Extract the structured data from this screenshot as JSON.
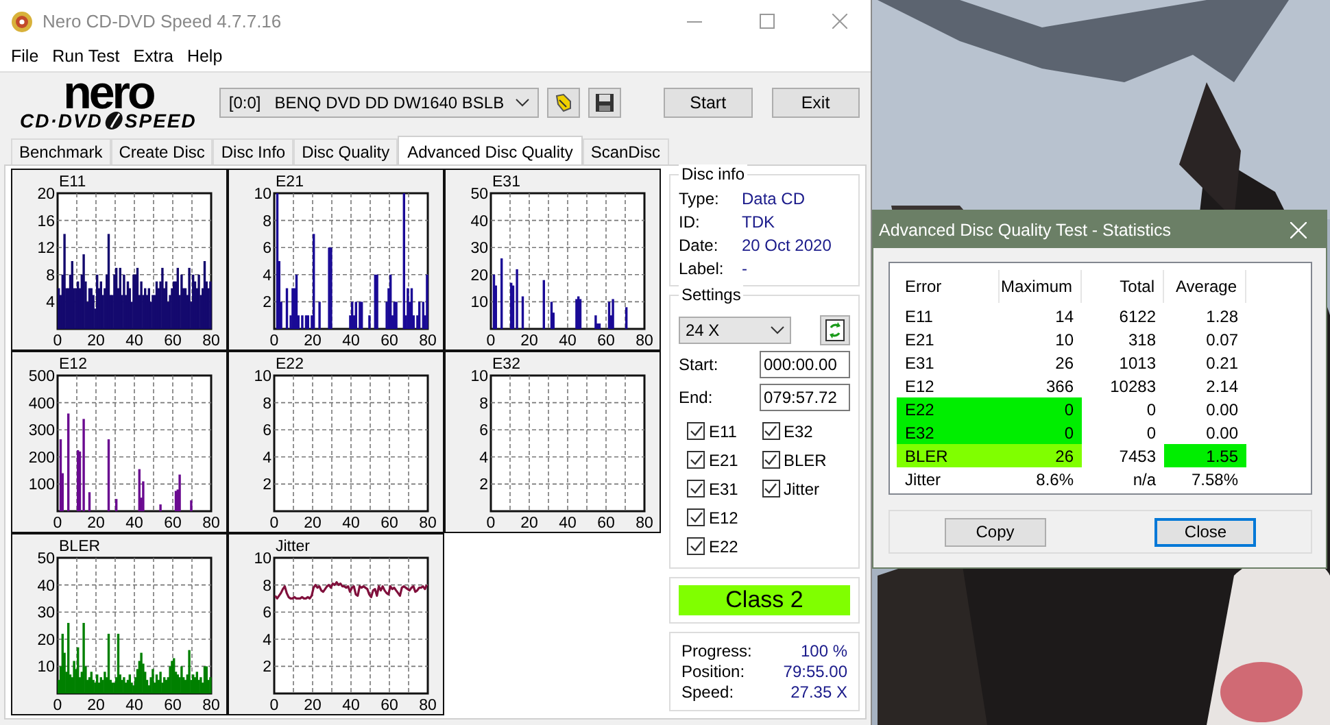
{
  "window": {
    "title": "Nero CD-DVD Speed 4.7.7.16"
  },
  "menu": [
    "File",
    "Run Test",
    "Extra",
    "Help"
  ],
  "toolbar": {
    "logo": {
      "top": "nero",
      "left": "CD·DVD",
      "right": "SPEED"
    },
    "drive": "[0:0]   BENQ DVD DD DW1640 BSLB",
    "buttons": [
      "Start",
      "Exit"
    ]
  },
  "tabs": [
    {
      "label": "Benchmark",
      "selected": false
    },
    {
      "label": "Create Disc",
      "selected": false
    },
    {
      "label": "Disc Info",
      "selected": false
    },
    {
      "label": "Disc Quality",
      "selected": false
    },
    {
      "label": "Advanced Disc Quality",
      "selected": true
    },
    {
      "label": "ScanDisc",
      "selected": false
    }
  ],
  "charts": [
    {
      "chart_data": {
        "type": "bar",
        "title": "E11",
        "grid": true,
        "x": [
          0,
          1,
          2,
          3,
          4,
          5,
          6,
          7,
          8,
          9,
          10,
          11,
          12,
          13,
          14,
          15,
          16,
          17,
          18,
          19,
          20,
          21,
          22,
          23,
          24,
          25,
          26,
          27,
          28,
          29,
          30,
          31,
          32,
          33,
          34,
          35,
          36,
          37,
          38,
          39,
          40,
          41,
          42,
          43,
          44,
          45,
          46,
          47,
          48,
          49,
          50,
          51,
          52,
          53,
          54,
          55,
          56,
          57,
          58,
          59,
          60,
          61,
          62,
          63,
          64,
          65,
          66,
          67,
          68,
          69,
          70,
          71,
          72,
          73,
          74,
          75,
          76,
          77,
          78,
          79
        ],
        "xlim": [
          0,
          80
        ],
        "ylim": [
          0,
          20
        ],
        "xticks": [
          0,
          20,
          40,
          60,
          80
        ],
        "yticks": [
          4,
          8,
          12,
          16,
          20
        ],
        "series": [
          {
            "color": "#14096e",
            "values": [
              6,
              5,
              8,
              14,
              6,
              6,
              8,
              10,
              6,
              6,
              7,
              6,
              8,
              11,
              7,
              4,
              6,
              6,
              5,
              3,
              8,
              6,
              7,
              5,
              6,
              8,
              14,
              5,
              5,
              8,
              9,
              6,
              9,
              5,
              8,
              5,
              7,
              6,
              4,
              8,
              8,
              9,
              5,
              7,
              5,
              6,
              5,
              6,
              4,
              5,
              5,
              7,
              6,
              7,
              9,
              6,
              7,
              4,
              5,
              6,
              7,
              7,
              9,
              5,
              8,
              6,
              6,
              5,
              9,
              4,
              8,
              7,
              6,
              8,
              5,
              6,
              10,
              7,
              6,
              7
            ]
          }
        ]
      }
    },
    {
      "chart_data": {
        "type": "bar",
        "title": "E21",
        "grid": true,
        "x": [
          0,
          1,
          2,
          3,
          4,
          5,
          6,
          7,
          8,
          9,
          10,
          11,
          12,
          13,
          14,
          15,
          16,
          17,
          18,
          19,
          20,
          21,
          22,
          23,
          24,
          25,
          26,
          27,
          28,
          29,
          30,
          31,
          32,
          33,
          34,
          35,
          36,
          37,
          38,
          39,
          40,
          41,
          42,
          43,
          44,
          45,
          46,
          47,
          48,
          49,
          50,
          51,
          52,
          53,
          54,
          55,
          56,
          57,
          58,
          59,
          60,
          61,
          62,
          63,
          64,
          65,
          66,
          67,
          68,
          69,
          70,
          71,
          72,
          73,
          74,
          75,
          76,
          77,
          78,
          79
        ],
        "xlim": [
          0,
          80
        ],
        "ylim": [
          0,
          10
        ],
        "xticks": [
          0,
          20,
          40,
          60,
          80
        ],
        "yticks": [
          2,
          4,
          6,
          8,
          10
        ],
        "series": [
          {
            "color": "#1a0a96",
            "values": [
              0,
              10,
              5,
              2,
              0,
              0,
              3,
              0,
              1,
              3,
              3,
              4,
              1,
              0,
              1,
              0,
              1,
              1,
              0,
              1,
              7,
              0,
              0,
              2,
              0,
              0,
              0,
              0,
              6,
              6,
              0,
              0,
              0,
              0,
              0,
              0,
              0,
              0,
              0,
              1,
              2,
              1,
              2,
              0,
              2,
              2,
              0,
              0,
              0,
              1,
              0,
              0,
              4,
              4,
              0,
              0,
              0,
              0,
              2,
              3,
              4,
              1,
              2,
              2,
              0,
              0,
              0,
              10,
              1,
              3,
              2,
              3,
              1,
              0,
              1,
              2,
              0,
              2,
              1,
              4
            ]
          }
        ]
      }
    },
    {
      "chart_data": {
        "type": "bar",
        "title": "E31",
        "grid": true,
        "x": [
          0,
          1,
          2,
          3,
          4,
          5,
          6,
          7,
          8,
          9,
          10,
          11,
          12,
          13,
          14,
          15,
          16,
          17,
          18,
          19,
          20,
          21,
          22,
          23,
          24,
          25,
          26,
          27,
          28,
          29,
          30,
          31,
          32,
          33,
          34,
          35,
          36,
          37,
          38,
          39,
          40,
          41,
          42,
          43,
          44,
          45,
          46,
          47,
          48,
          49,
          50,
          51,
          52,
          53,
          54,
          55,
          56,
          57,
          58,
          59,
          60,
          61,
          62,
          63,
          64,
          65,
          66,
          67,
          68,
          69,
          70,
          71,
          72,
          73,
          74,
          75,
          76,
          77,
          78,
          79
        ],
        "xlim": [
          0,
          80
        ],
        "ylim": [
          0,
          50
        ],
        "xticks": [
          0,
          20,
          40,
          60,
          80
        ],
        "yticks": [
          10,
          20,
          30,
          40,
          50
        ],
        "series": [
          {
            "color": "#1a0a96",
            "values": [
              0,
              20,
              16,
              0,
              0,
              26,
              0,
              0,
              0,
              0,
              17,
              16,
              0,
              22,
              0,
              0,
              12,
              0,
              0,
              0,
              0,
              0,
              0,
              0,
              0,
              0,
              0,
              18,
              0,
              0,
              0,
              10,
              6,
              0,
              0,
              0,
              0,
              0,
              0,
              0,
              0,
              0,
              0,
              0,
              11,
              12,
              11,
              0,
              0,
              0,
              0,
              0,
              0,
              0,
              5,
              2,
              2,
              0,
              0,
              0,
              0,
              10,
              5,
              11,
              0,
              0,
              0,
              0,
              0,
              0,
              8,
              0,
              0,
              0,
              0,
              0,
              0,
              0,
              0,
              0
            ]
          }
        ]
      }
    },
    {
      "chart_data": {
        "type": "bar",
        "title": "E12",
        "grid": true,
        "x": [
          0,
          1,
          2,
          3,
          4,
          5,
          6,
          7,
          8,
          9,
          10,
          11,
          12,
          13,
          14,
          15,
          16,
          17,
          18,
          19,
          20,
          21,
          22,
          23,
          24,
          25,
          26,
          27,
          28,
          29,
          30,
          31,
          32,
          33,
          34,
          35,
          36,
          37,
          38,
          39,
          40,
          41,
          42,
          43,
          44,
          45,
          46,
          47,
          48,
          49,
          50,
          51,
          52,
          53,
          54,
          55,
          56,
          57,
          58,
          59,
          60,
          61,
          62,
          63,
          64,
          65,
          66,
          67,
          68,
          69,
          70,
          71,
          72,
          73,
          74,
          75,
          76,
          77,
          78,
          79
        ],
        "xlim": [
          0,
          80
        ],
        "ylim": [
          0,
          500
        ],
        "xticks": [
          0,
          20,
          40,
          60,
          80
        ],
        "yticks": [
          100,
          200,
          300,
          400,
          500
        ],
        "series": [
          {
            "color": "#6a0a90",
            "values": [
              0,
              265,
              140,
              0,
              0,
              360,
              0,
              0,
              0,
              0,
              225,
              220,
              0,
              340,
              0,
              0,
              70,
              0,
              0,
              0,
              0,
              0,
              0,
              0,
              0,
              0,
              265,
              0,
              0,
              0,
              45,
              0,
              0,
              0,
              0,
              0,
              0,
              0,
              0,
              0,
              0,
              0,
              155,
              50,
              110,
              0,
              0,
              0,
              0,
              0,
              0,
              0,
              0,
              25,
              0,
              0,
              0,
              0,
              0,
              0,
              0,
              75,
              80,
              135,
              0,
              0,
              0,
              0,
              0,
              40,
              0,
              0,
              0,
              0,
              0,
              0,
              0,
              0,
              0,
              0
            ]
          }
        ]
      }
    },
    {
      "chart_data": {
        "type": "bar",
        "title": "E22",
        "grid": true,
        "x": [
          0,
          1,
          2,
          3,
          4,
          5,
          6,
          7,
          8,
          9,
          10,
          11,
          12,
          13,
          14,
          15,
          16,
          17,
          18,
          19,
          20,
          21,
          22,
          23,
          24,
          25,
          26,
          27,
          28,
          29,
          30,
          31,
          32,
          33,
          34,
          35,
          36,
          37,
          38,
          39,
          40,
          41,
          42,
          43,
          44,
          45,
          46,
          47,
          48,
          49,
          50,
          51,
          52,
          53,
          54,
          55,
          56,
          57,
          58,
          59,
          60,
          61,
          62,
          63,
          64,
          65,
          66,
          67,
          68,
          69,
          70,
          71,
          72,
          73,
          74,
          75,
          76,
          77,
          78,
          79
        ],
        "xlim": [
          0,
          80
        ],
        "ylim": [
          0,
          10
        ],
        "xticks": [
          0,
          20,
          40,
          60,
          80
        ],
        "yticks": [
          2,
          4,
          6,
          8,
          10
        ],
        "values": [
          0,
          0,
          0,
          0,
          0,
          0,
          0,
          0,
          0,
          0,
          0,
          0,
          0,
          0,
          0,
          0,
          0,
          0,
          0,
          0,
          0,
          0,
          0,
          0,
          0,
          0,
          0,
          0,
          0,
          0,
          0,
          0,
          0,
          0,
          0,
          0,
          0,
          0,
          0,
          0,
          0,
          0,
          0,
          0,
          0,
          0,
          0,
          0,
          0,
          0,
          0,
          0,
          0,
          0,
          0,
          0,
          0,
          0,
          0,
          0,
          0,
          0,
          0,
          0,
          0,
          0,
          0,
          0,
          0,
          0,
          0,
          0,
          0,
          0,
          0,
          0,
          0,
          0,
          0,
          0
        ]
      }
    },
    {
      "chart_data": {
        "type": "bar",
        "title": "E32",
        "grid": true,
        "x": [
          0,
          1,
          2,
          3,
          4,
          5,
          6,
          7,
          8,
          9,
          10,
          11,
          12,
          13,
          14,
          15,
          16,
          17,
          18,
          19,
          20,
          21,
          22,
          23,
          24,
          25,
          26,
          27,
          28,
          29,
          30,
          31,
          32,
          33,
          34,
          35,
          36,
          37,
          38,
          39,
          40,
          41,
          42,
          43,
          44,
          45,
          46,
          47,
          48,
          49,
          50,
          51,
          52,
          53,
          54,
          55,
          56,
          57,
          58,
          59,
          60,
          61,
          62,
          63,
          64,
          65,
          66,
          67,
          68,
          69,
          70,
          71,
          72,
          73,
          74,
          75,
          76,
          77,
          78,
          79
        ],
        "xlim": [
          0,
          80
        ],
        "ylim": [
          0,
          10
        ],
        "xticks": [
          0,
          20,
          40,
          60,
          80
        ],
        "yticks": [
          2,
          4,
          6,
          8,
          10
        ],
        "values": [
          0,
          0,
          0,
          0,
          0,
          0,
          0,
          0,
          0,
          0,
          0,
          0,
          0,
          0,
          0,
          0,
          0,
          0,
          0,
          0,
          0,
          0,
          0,
          0,
          0,
          0,
          0,
          0,
          0,
          0,
          0,
          0,
          0,
          0,
          0,
          0,
          0,
          0,
          0,
          0,
          0,
          0,
          0,
          0,
          0,
          0,
          0,
          0,
          0,
          0,
          0,
          0,
          0,
          0,
          0,
          0,
          0,
          0,
          0,
          0,
          0,
          0,
          0,
          0,
          0,
          0,
          0,
          0,
          0,
          0,
          0,
          0,
          0,
          0,
          0,
          0,
          0,
          0,
          0,
          0
        ]
      }
    },
    {
      "chart_data": {
        "type": "bar",
        "title": "BLER",
        "grid": true,
        "x": [
          0,
          1,
          2,
          3,
          4,
          5,
          6,
          7,
          8,
          9,
          10,
          11,
          12,
          13,
          14,
          15,
          16,
          17,
          18,
          19,
          20,
          21,
          22,
          23,
          24,
          25,
          26,
          27,
          28,
          29,
          30,
          31,
          32,
          33,
          34,
          35,
          36,
          37,
          38,
          39,
          40,
          41,
          42,
          43,
          44,
          45,
          46,
          47,
          48,
          49,
          50,
          51,
          52,
          53,
          54,
          55,
          56,
          57,
          58,
          59,
          60,
          61,
          62,
          63,
          64,
          65,
          66,
          67,
          68,
          69,
          70,
          71,
          72,
          73,
          74,
          75,
          76,
          77,
          78,
          79
        ],
        "xlim": [
          0,
          80
        ],
        "ylim": [
          0,
          50
        ],
        "xticks": [
          0,
          20,
          40,
          60,
          80
        ],
        "yticks": [
          10,
          20,
          30,
          40,
          50
        ],
        "series": [
          {
            "color": "#008000",
            "values": [
              5,
              10,
              22,
              15,
              8,
              26,
              7,
              6,
              12,
              9,
              17,
              6,
              8,
              26,
              10,
              5,
              6,
              8,
              5,
              4,
              7,
              4,
              6,
              5,
              8,
              6,
              22,
              5,
              4,
              4,
              6,
              22,
              7,
              5,
              6,
              4,
              5,
              7,
              4,
              3,
              6,
              9,
              12,
              15,
              11,
              8,
              5,
              3,
              6,
              9,
              4,
              7,
              5,
              8,
              4,
              6,
              5,
              6,
              10,
              12,
              13,
              8,
              7,
              6,
              10,
              6,
              5,
              7,
              16,
              5,
              7,
              6,
              8,
              5,
              6,
              4,
              10,
              10,
              5,
              6
            ]
          }
        ]
      }
    },
    {
      "chart_data": {
        "type": "line",
        "title": "Jitter",
        "grid": true,
        "x": [
          0,
          1,
          2,
          3,
          4,
          5,
          6,
          7,
          8,
          9,
          10,
          11,
          12,
          13,
          14,
          15,
          16,
          17,
          18,
          19,
          20,
          21,
          22,
          23,
          24,
          25,
          26,
          27,
          28,
          29,
          30,
          31,
          32,
          33,
          34,
          35,
          36,
          37,
          38,
          39,
          40,
          41,
          42,
          43,
          44,
          45,
          46,
          47,
          48,
          49,
          50,
          51,
          52,
          53,
          54,
          55,
          56,
          57,
          58,
          59,
          60,
          61,
          62,
          63,
          64,
          65,
          66,
          67,
          68,
          69,
          70,
          71,
          72,
          73,
          74,
          75,
          76,
          77,
          78,
          79
        ],
        "xlim": [
          0,
          80
        ],
        "ylim": [
          0,
          10
        ],
        "xticks": [
          0,
          20,
          40,
          60,
          80
        ],
        "yticks": [
          2,
          4,
          6,
          8,
          10
        ],
        "series": [
          {
            "color": "#80103c",
            "values": [
              7.2,
              7,
              7.2,
              7.4,
              7.7,
              7.9,
              7.4,
              7.1,
              7,
              7,
              7.1,
              7,
              7,
              7,
              7.1,
              7,
              7,
              7.1,
              7,
              7.2,
              7.8,
              8,
              7.8,
              7.9,
              7.6,
              7.5,
              7.7,
              7.9,
              8,
              7.8,
              8.1,
              8,
              8.2,
              8,
              8.1,
              7.9,
              7.9,
              7.8,
              7.9,
              7.5,
              7.8,
              7.9,
              7.3,
              7.2,
              7.9,
              7.8,
              7.9,
              7.8,
              7.7,
              7.3,
              7.1,
              7.6,
              7.7,
              7.2,
              7.9,
              7.6,
              7.9,
              7.6,
              7.4,
              7.3,
              7.9,
              7.7,
              7.8,
              7.6,
              7.4,
              7.2,
              7.8,
              7.9,
              7.8,
              7.7,
              7.6,
              7.8,
              7.9,
              7.5,
              7.6,
              7.8,
              7.8,
              7.9,
              7.7,
              8
            ]
          }
        ]
      }
    }
  ],
  "disc_info": {
    "title": "Disc info",
    "fields": [
      {
        "label": "Type:",
        "value": "Data CD"
      },
      {
        "label": "ID:",
        "value": "TDK"
      },
      {
        "label": "Date:",
        "value": "20 Oct 2020"
      },
      {
        "label": "Label:",
        "value": "-"
      }
    ]
  },
  "settings": {
    "title": "Settings",
    "speed": "24 X",
    "start_label": "Start:",
    "start": "000:00.00",
    "end_label": "End:",
    "end": "079:57.72",
    "checks": [
      {
        "label": "E11",
        "checked": true
      },
      {
        "label": "E21",
        "checked": true
      },
      {
        "label": "E31",
        "checked": true
      },
      {
        "label": "E12",
        "checked": true
      },
      {
        "label": "E22",
        "checked": true
      },
      {
        "label": "E32",
        "checked": true
      },
      {
        "label": "BLER",
        "checked": true
      },
      {
        "label": "Jitter",
        "checked": true
      }
    ]
  },
  "result": {
    "text": "Class 2",
    "color": "#80ff00"
  },
  "progress": [
    {
      "label": "Progress:",
      "value": "100 %"
    },
    {
      "label": "Position:",
      "value": "79:55.00"
    },
    {
      "label": "Speed:",
      "value": "27.35 X"
    }
  ],
  "dialog": {
    "title": "Advanced Disc Quality Test - Statistics",
    "columns": [
      "Error",
      "Maximum",
      "Total",
      "Average"
    ],
    "rows": [
      {
        "cells": [
          {
            "text": "E11"
          },
          {
            "text": "14"
          },
          {
            "text": "6122"
          },
          {
            "text": "1.28"
          }
        ]
      },
      {
        "cells": [
          {
            "text": "E21"
          },
          {
            "text": "10"
          },
          {
            "text": "318"
          },
          {
            "text": "0.07"
          }
        ]
      },
      {
        "cells": [
          {
            "text": "E31"
          },
          {
            "text": "26"
          },
          {
            "text": "1013"
          },
          {
            "text": "0.21"
          }
        ]
      },
      {
        "cells": [
          {
            "text": "E12"
          },
          {
            "text": "366"
          },
          {
            "text": "10283"
          },
          {
            "text": "2.14"
          }
        ]
      },
      {
        "cells": [
          {
            "text": "E22",
            "color": "#00ee00"
          },
          {
            "text": "0",
            "color": "#00ee00"
          },
          {
            "text": "0"
          },
          {
            "text": "0.00"
          }
        ]
      },
      {
        "cells": [
          {
            "text": "E32",
            "color": "#00ee00"
          },
          {
            "text": "0",
            "color": "#00ee00"
          },
          {
            "text": "0"
          },
          {
            "text": "0.00"
          }
        ]
      },
      {
        "cells": [
          {
            "text": "BLER",
            "color": "#80ff00"
          },
          {
            "text": "26",
            "color": "#80ff00"
          },
          {
            "text": "7453"
          },
          {
            "text": "1.55",
            "color": "#00ee00"
          }
        ]
      },
      {
        "cells": [
          {
            "text": "Jitter"
          },
          {
            "text": "8.6%"
          },
          {
            "text": "n/a"
          },
          {
            "text": "7.58%"
          }
        ]
      }
    ],
    "buttons": [
      {
        "label": "Copy",
        "focused": false
      },
      {
        "label": "Close",
        "focused": true
      }
    ]
  }
}
